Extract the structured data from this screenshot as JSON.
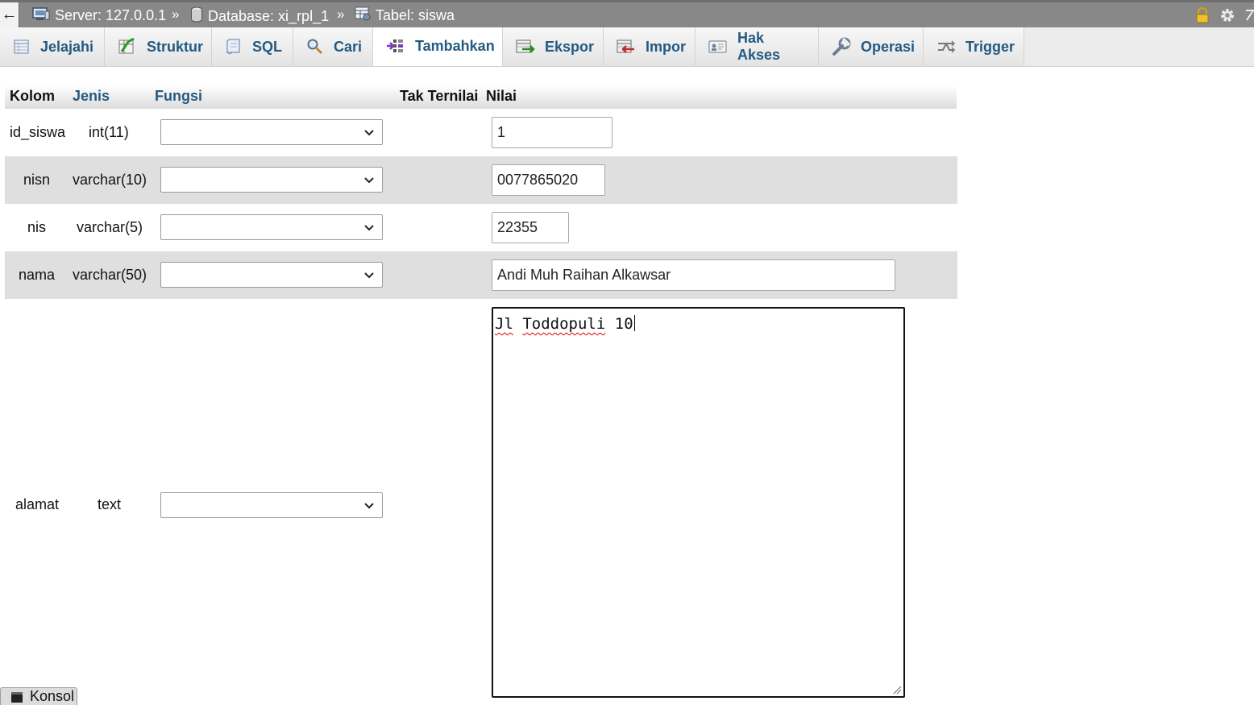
{
  "breadcrumb": {
    "back": "←",
    "server": "Server: 127.0.0.1",
    "sep1": "»",
    "database": "Database: xi_rpl_1",
    "sep2": "»",
    "table": "Tabel: siswa"
  },
  "tabs": [
    {
      "label": "Jelajahi",
      "icon": "browse-icon"
    },
    {
      "label": "Struktur",
      "icon": "structure-icon"
    },
    {
      "label": "SQL",
      "icon": "sql-icon"
    },
    {
      "label": "Cari",
      "icon": "search-icon"
    },
    {
      "label": "Tambahkan",
      "icon": "insert-icon",
      "active": true
    },
    {
      "label": "Ekspor",
      "icon": "export-icon"
    },
    {
      "label": "Impor",
      "icon": "import-icon"
    },
    {
      "label": "Hak Akses",
      "icon": "privileges-icon"
    },
    {
      "label": "Operasi",
      "icon": "operations-icon"
    },
    {
      "label": "Trigger",
      "icon": "triggers-icon"
    }
  ],
  "headers": {
    "kolom": "Kolom",
    "jenis": "Jenis",
    "fungsi": "Fungsi",
    "tak_ternilai": "Tak Ternilai",
    "nilai": "Nilai"
  },
  "rows": [
    {
      "kolom": "id_siswa",
      "jenis": "int(11)",
      "fungsi": "",
      "nilai": "1"
    },
    {
      "kolom": "nisn",
      "jenis": "varchar(10)",
      "fungsi": "",
      "nilai": "0077865020"
    },
    {
      "kolom": "nis",
      "jenis": "varchar(5)",
      "fungsi": "",
      "nilai": "22355"
    },
    {
      "kolom": "nama",
      "jenis": "varchar(50)",
      "fungsi": "",
      "nilai": "Andi Muh Raihan Alkawsar"
    },
    {
      "kolom": "alamat",
      "jenis": "text",
      "fungsi": "",
      "nilai_words": [
        "Jl",
        "Toddopuli",
        "10"
      ]
    }
  ],
  "konsol": "Konsol",
  "colors": {
    "link": "#235a81",
    "topbar": "#888888",
    "alt_row": "#dfdfdf"
  }
}
